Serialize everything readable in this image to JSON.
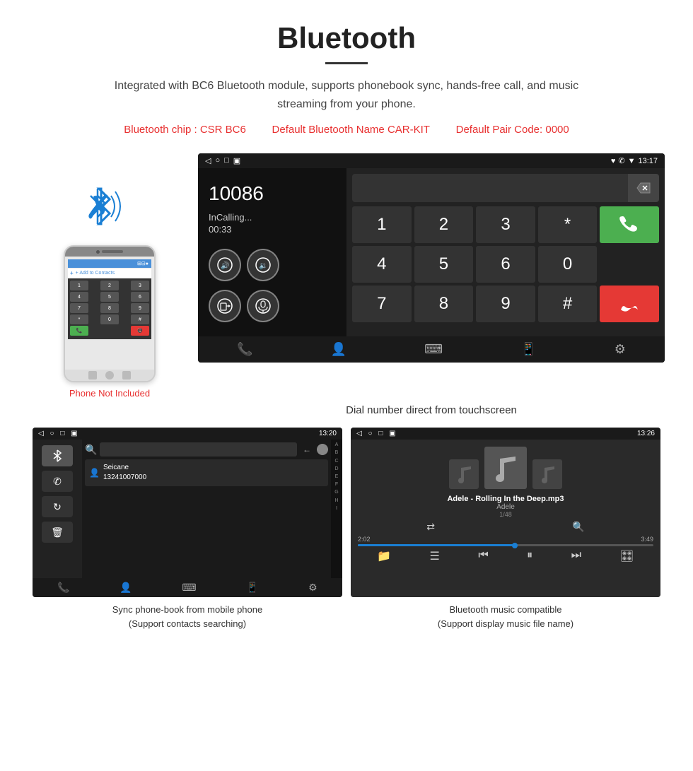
{
  "header": {
    "title": "Bluetooth",
    "description": "Integrated with BC6 Bluetooth module, supports phonebook sync, hands-free call, and music streaming from your phone.",
    "spec_chip": "Bluetooth chip : CSR BC6",
    "spec_name": "Default Bluetooth Name CAR-KIT",
    "spec_code": "Default Pair Code: 0000"
  },
  "phone": {
    "not_included": "Phone Not Included",
    "add_contacts": "+ Add to Contacts"
  },
  "android_dialer": {
    "status_left": [
      "◁",
      "○",
      "□",
      "▣"
    ],
    "status_right": "♥ ✆ ▼ 13:17",
    "number": "10086",
    "in_calling": "InCalling...",
    "timer": "00:33",
    "vol_up": "🔊+",
    "vol_down": "🔉",
    "transfer": "📱→",
    "mic": "🎤",
    "keys": [
      "1",
      "2",
      "3",
      "*",
      "4",
      "5",
      "6",
      "0",
      "7",
      "8",
      "9",
      "#"
    ],
    "call_green": "📞",
    "call_red": "📞",
    "del_icon": "⌫"
  },
  "dialer_caption": "Dial number direct from touchscreen",
  "phonebook": {
    "status_right": "13:20",
    "contact_name": "Seicane",
    "contact_number": "13241007000",
    "alphabet": [
      "A",
      "B",
      "C",
      "D",
      "E",
      "F",
      "G",
      "H",
      "I"
    ],
    "caption_line1": "Sync phone-book from mobile phone",
    "caption_line2": "(Support contacts searching)"
  },
  "music": {
    "status_right": "13:26",
    "track": "Adele - Rolling In the Deep.mp3",
    "artist": "Adele",
    "count": "1/48",
    "time_current": "2:02",
    "time_total": "3:49",
    "progress_percent": 53,
    "caption_line1": "Bluetooth music compatible",
    "caption_line2": "(Support display music file name)"
  }
}
